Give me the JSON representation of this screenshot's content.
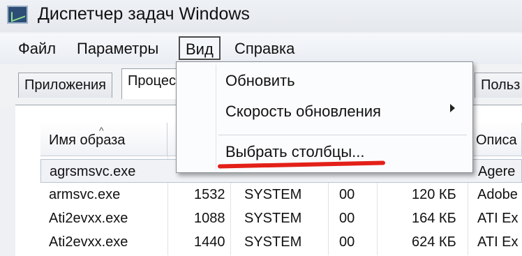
{
  "window": {
    "title": "Диспетчер задач Windows"
  },
  "menu": [
    "Файл",
    "Параметры",
    "Вид",
    "Справка"
  ],
  "tabs": [
    "Приложения",
    "Процес",
    "Польз"
  ],
  "view_menu": {
    "items": [
      "Обновить",
      "Скорость обновления",
      "Выбрать столбцы..."
    ],
    "annotation_color": "#e32018"
  },
  "table": {
    "headers": [
      "Имя образа",
      "",
      "",
      "",
      "",
      "Описа"
    ],
    "rows": [
      [
        "agrsmsvc.exe",
        "",
        "",
        "",
        "",
        "Agere"
      ],
      [
        "armsvc.exe",
        "1532",
        "SYSTEM",
        "00",
        "120 КБ",
        "Adobe"
      ],
      [
        "Ati2evxx.exe",
        "1088",
        "SYSTEM",
        "00",
        "164 КБ",
        "ATI Ex"
      ],
      [
        "Ati2evxx.exe",
        "1440",
        "SYSTEM",
        "00",
        "624 КБ",
        "ATI Ex"
      ]
    ]
  }
}
